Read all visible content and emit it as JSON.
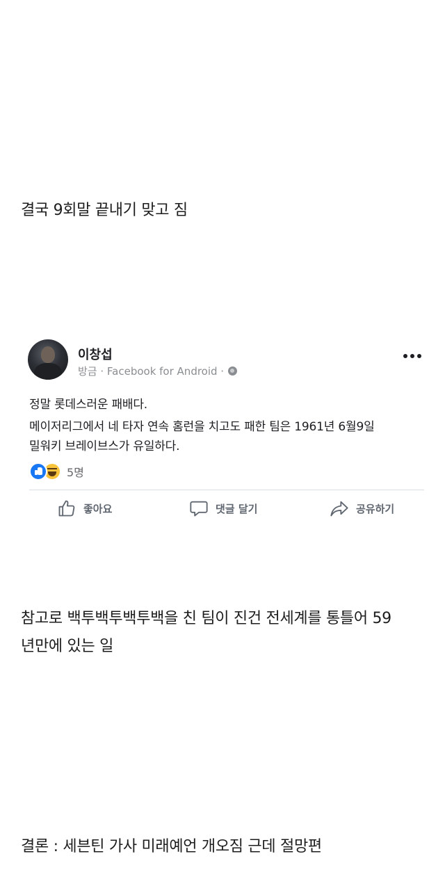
{
  "captions": {
    "line1": "결국 9회말 끝내기 맞고 짐",
    "line2a": "참고로 백투백투백투백을 친 팀이 진건 전세계를 통틀어 59",
    "line2b": "년만에 있는 일",
    "line3": "결론 : 세븐틴 가사 미래예언 개오짐 근데 절망편"
  },
  "post": {
    "author": "이창섭",
    "meta": "방금 · Facebook for Android ·",
    "privacy_icon": "globe-icon",
    "more_icon": "more-options-icon",
    "text_line1": "정말 롯데스러운 패배다.",
    "text_line2": "메이저리그에서 네 타자 연속 홈런을 치고도 패한 팀은 1961년 6월9일",
    "text_line3": "밀워키 브레이브스가 유일하다.",
    "reactions": {
      "icons": [
        "like-reaction-icon",
        "haha-reaction-icon"
      ],
      "count": "5명"
    },
    "actions": {
      "like": "좋아요",
      "comment": "댓글 달기",
      "share": "공유하기"
    }
  },
  "colors": {
    "facebook_blue": "#1877f2",
    "meta_gray": "#8a8d91",
    "action_gray": "#606770"
  }
}
